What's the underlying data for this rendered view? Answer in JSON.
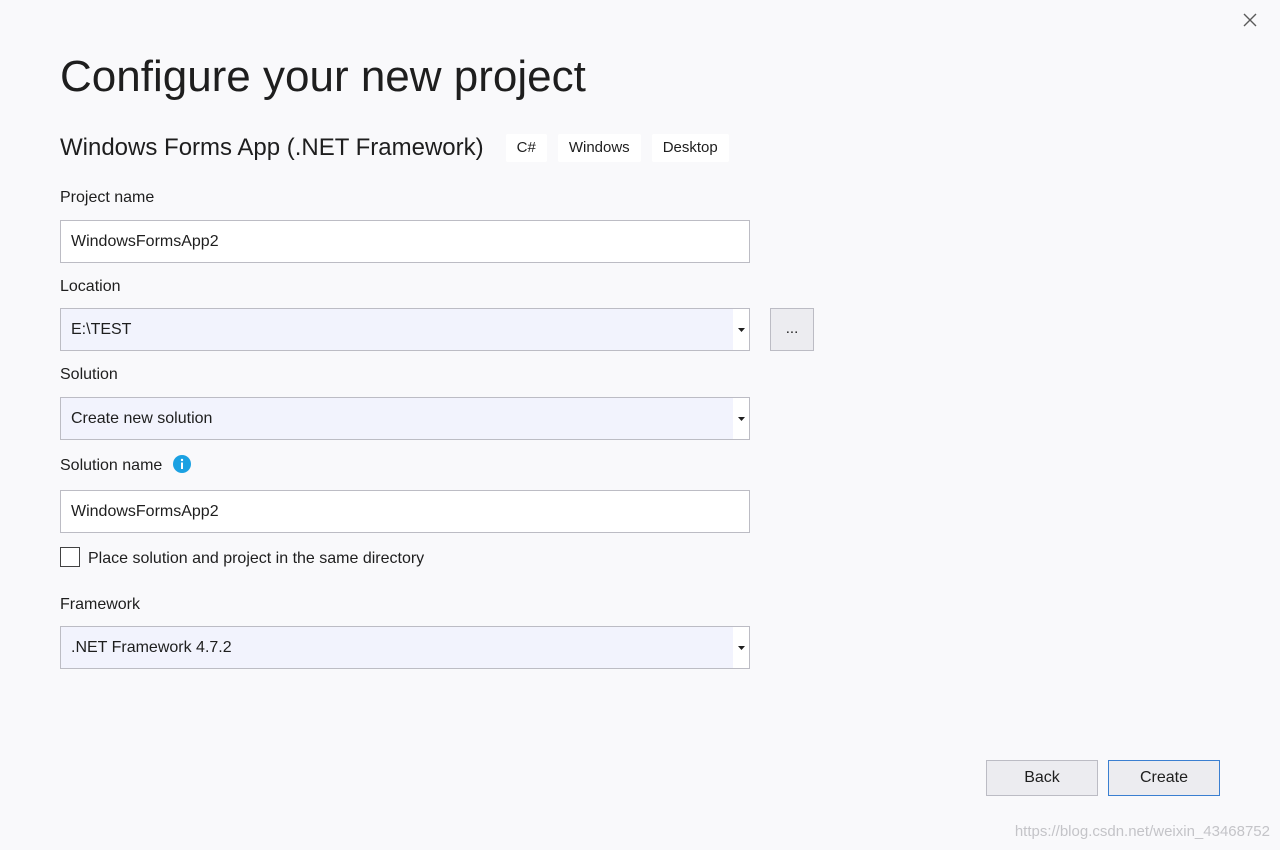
{
  "dialog": {
    "title": "Configure your new project",
    "template_name": "Windows Forms App (.NET Framework)",
    "tags": [
      "C#",
      "Windows",
      "Desktop"
    ]
  },
  "project_name": {
    "label": "Project name",
    "value": "WindowsFormsApp2"
  },
  "location": {
    "label": "Location",
    "value": "E:\\TEST",
    "browse_label": "..."
  },
  "solution": {
    "label": "Solution",
    "value": "Create new solution"
  },
  "solution_name": {
    "label": "Solution name",
    "value": "WindowsFormsApp2",
    "info_icon": "info-icon"
  },
  "same_directory": {
    "label": "Place solution and project in the same directory",
    "checked": false
  },
  "framework": {
    "label": "Framework",
    "value": ".NET Framework 4.7.2"
  },
  "buttons": {
    "back": "Back",
    "create": "Create"
  },
  "watermark": "https://blog.csdn.net/weixin_43468752",
  "colors": {
    "accent": "#3a7fd1",
    "info": "#1ba1e2",
    "background": "#f9f9fb"
  }
}
